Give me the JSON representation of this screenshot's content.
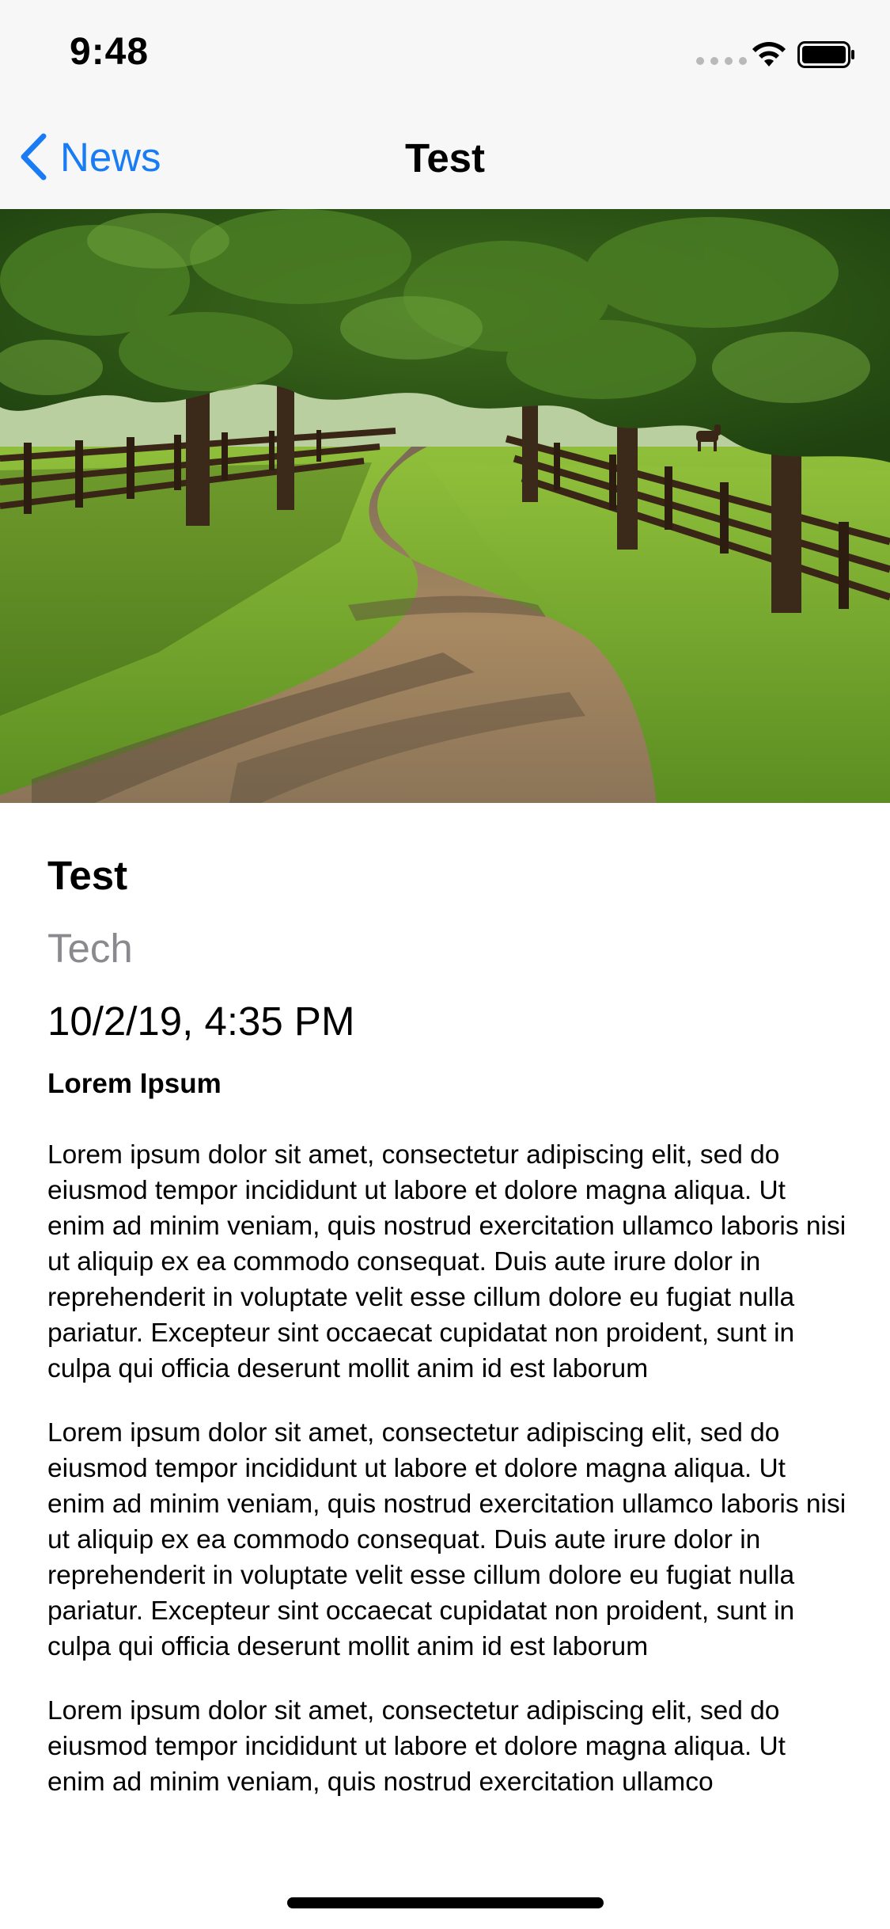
{
  "status_bar": {
    "time": "9:48",
    "icons": [
      "signal-dots-icon",
      "wifi-icon",
      "battery-icon"
    ]
  },
  "nav": {
    "back_label": "News",
    "title": "Test",
    "accent_color": "#1a7cf5"
  },
  "hero_image": {
    "description_icon": "tree-lined-road-photo"
  },
  "article": {
    "title": "Test",
    "category": "Tech",
    "date": "10/2/19, 4:35 PM",
    "heading": "Lorem Ipsum",
    "paragraphs": [
      "Lorem ipsum dolor sit amet, consectetur adipiscing elit, sed do eiusmod tempor incididunt ut labore et dolore magna aliqua. Ut enim ad minim veniam, quis nostrud exercitation ullamco laboris nisi ut aliquip ex ea commodo consequat. Duis aute irure dolor in reprehenderit in voluptate velit esse cillum dolore eu fugiat nulla pariatur. Excepteur sint occaecat cupidatat non proident, sunt in culpa qui officia deserunt mollit anim id est laborum",
      "Lorem ipsum dolor sit amet, consectetur adipiscing elit, sed do eiusmod tempor incididunt ut labore et dolore magna aliqua. Ut enim ad minim veniam, quis nostrud exercitation ullamco laboris nisi ut aliquip ex ea commodo consequat. Duis aute irure dolor in reprehenderit in voluptate velit esse cillum dolore eu fugiat nulla pariatur. Excepteur sint occaecat cupidatat non proident, sunt in culpa qui officia deserunt mollit anim id est laborum",
      "Lorem ipsum dolor sit amet, consectetur adipiscing elit, sed do eiusmod tempor incididunt ut labore et dolore magna aliqua. Ut enim ad minim veniam, quis nostrud exercitation ullamco"
    ]
  }
}
